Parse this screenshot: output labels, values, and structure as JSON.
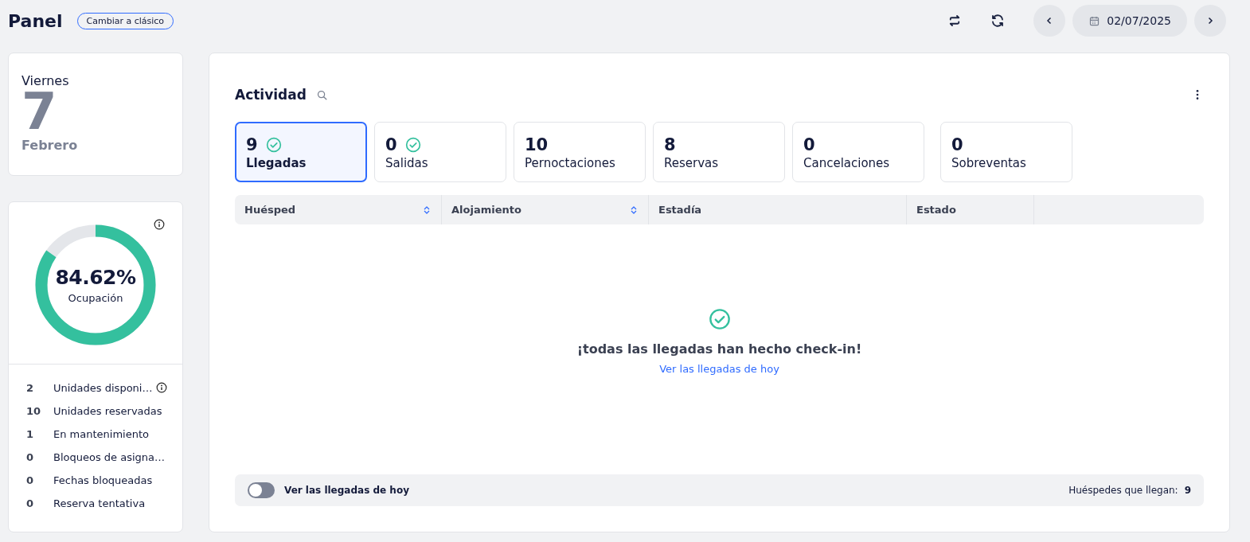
{
  "header": {
    "title": "Panel",
    "switch_button": "Cambiar a clásico",
    "date": "02/07/2025"
  },
  "date_card": {
    "weekday": "Viernes",
    "day": "7",
    "month": "Febrero"
  },
  "occupancy": {
    "value": "84.62%",
    "label": "Ocupación",
    "level": 0.8462
  },
  "stats": [
    {
      "count": "2",
      "label": "Unidades disponi…",
      "info": true
    },
    {
      "count": "10",
      "label": "Unidades reservadas",
      "info": false
    },
    {
      "count": "1",
      "label": "En mantenimiento",
      "info": false
    },
    {
      "count": "0",
      "label": "Bloqueos de asigna…",
      "info": false
    },
    {
      "count": "0",
      "label": "Fechas bloqueadas",
      "info": false
    },
    {
      "count": "0",
      "label": "Reserva tentativa",
      "info": false
    }
  ],
  "activity": {
    "title": "Actividad",
    "tabs": [
      {
        "count": "9",
        "label": "Llegadas",
        "done": true,
        "selected": true
      },
      {
        "count": "0",
        "label": "Salidas",
        "done": true,
        "selected": false
      },
      {
        "count": "10",
        "label": "Pernoctaciones",
        "done": false,
        "selected": false
      },
      {
        "count": "8",
        "label": "Reservas",
        "done": false,
        "selected": false
      },
      {
        "count": "0",
        "label": "Cancelaciones",
        "done": false,
        "selected": false
      },
      {
        "count": "0",
        "label": "Sobreventas",
        "done": false,
        "selected": false
      }
    ],
    "columns": [
      {
        "label": "Huésped",
        "sortable": true
      },
      {
        "label": "Alojamiento",
        "sortable": true
      },
      {
        "label": "Estadía",
        "sortable": false
      },
      {
        "label": "Estado",
        "sortable": false
      }
    ],
    "empty_message": "¡todas las llegadas han hecho check-in!",
    "empty_link": "Ver las llegadas de hoy",
    "footer": {
      "toggle_label": "Ver las llegadas de hoy",
      "toggle_on": false,
      "count_label": "Huéspedes que llegan:",
      "count": "9"
    }
  }
}
